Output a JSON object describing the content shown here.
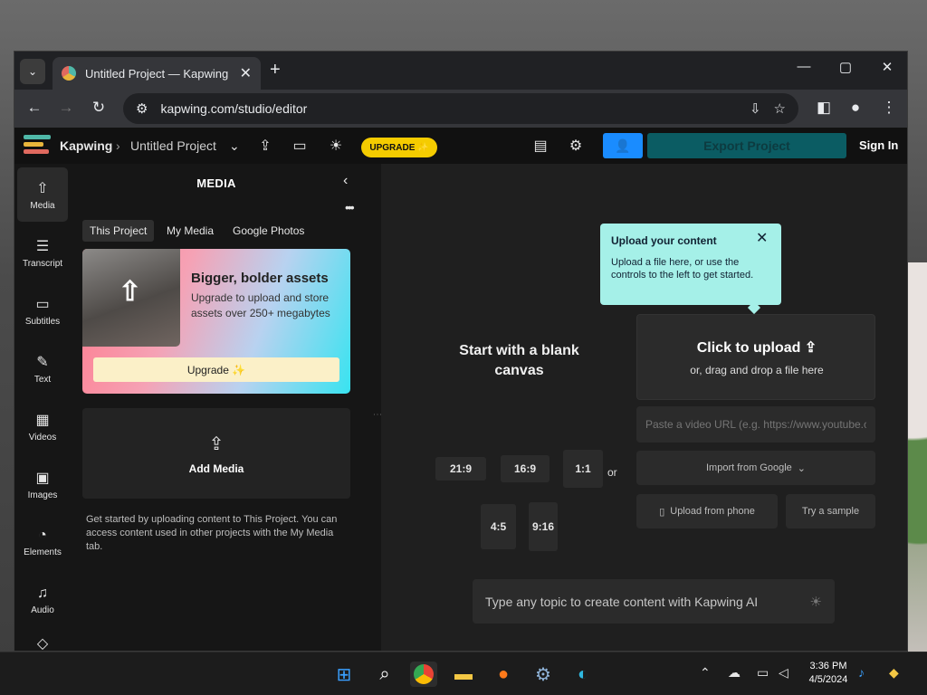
{
  "browser": {
    "tab_title": "Untitled Project — Kapwing",
    "url": "kapwing.com/studio/editor"
  },
  "header": {
    "brand": "Kapwing",
    "project": "Untitled Project",
    "upgrade_label": "UPGRADE ✨",
    "export_label": "Export Project",
    "signin_label": "Sign In"
  },
  "rail": [
    {
      "label": "Media",
      "icon": "upload-cloud-icon"
    },
    {
      "label": "Transcript",
      "icon": "transcript-icon"
    },
    {
      "label": "Subtitles",
      "icon": "subtitles-icon"
    },
    {
      "label": "Text",
      "icon": "text-icon"
    },
    {
      "label": "Videos",
      "icon": "film-icon"
    },
    {
      "label": "Images",
      "icon": "image-icon"
    },
    {
      "label": "Elements",
      "icon": "shapes-icon"
    },
    {
      "label": "Audio",
      "icon": "music-icon"
    }
  ],
  "panel": {
    "title": "MEDIA",
    "tabs": [
      "This Project",
      "My Media",
      "Google Photos"
    ],
    "promo": {
      "heading": "Bigger, bolder assets",
      "body": "Upgrade to upload and store assets over 250+ megabytes",
      "button": "Upgrade ✨"
    },
    "add_media": "Add Media",
    "info": "Get started by uploading content to This Project. You can access content used in other projects with the My Media tab."
  },
  "canvas": {
    "tooltip_heading": "Upload your content",
    "tooltip_body": "Upload a file here, or use the controls to the left to get started.",
    "blank_title": "Start with a blank canvas",
    "ratios": [
      "21:9",
      "16:9",
      "1:1",
      "4:5",
      "9:16"
    ],
    "or": "or",
    "upload_heading": "Click to upload",
    "upload_sub": "or, drag and drop a file here",
    "url_placeholder": "Paste a video URL (e.g. https://www.youtube.com/watch?v=...)",
    "import_google": "Import from Google",
    "upload_phone": "Upload from phone",
    "try_sample": "Try a sample",
    "ai_placeholder": "Type any topic to create content with Kapwing AI"
  },
  "taskbar": {
    "time": "3:36 PM",
    "date": "4/5/2024"
  },
  "colors": {
    "accent_blue": "#1a8cff",
    "export_teal": "#0b5c63",
    "upgrade_yellow": "#f5cc00",
    "tooltip_mint": "#a5f0e8"
  }
}
